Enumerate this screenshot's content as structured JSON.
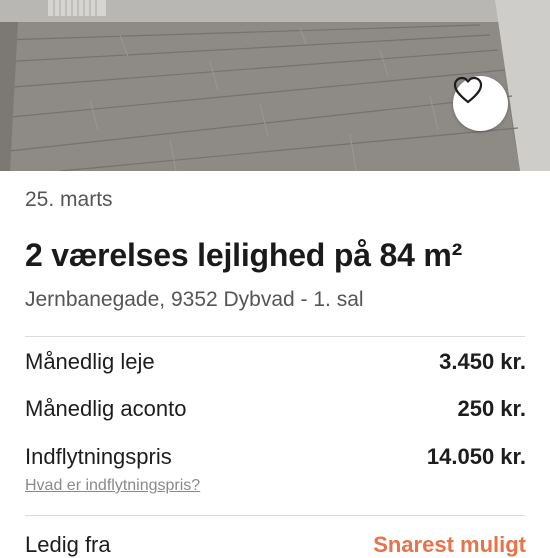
{
  "listing": {
    "date": "25. marts",
    "title": "2 værelses lejlighed på 84 m²",
    "address": "Jernbanegade, 9352 Dybvad - 1. sal"
  },
  "icons": {
    "favorite": "heart-outline-icon"
  },
  "prices": [
    {
      "label": "Månedlig leje",
      "value": "3.450 kr."
    },
    {
      "label": "Månedlig aconto",
      "value": "250 kr."
    },
    {
      "label": "Indflytningspris",
      "value": "14.050 kr."
    }
  ],
  "move_in_help_link": "Hvad er indflytningspris?",
  "availability": {
    "label": "Ledig fra",
    "value": "Snarest muligt"
  },
  "colors": {
    "accent": "#e8734a",
    "text": "#1d1d1d",
    "muted": "#555555",
    "link": "#8a8a8a"
  }
}
